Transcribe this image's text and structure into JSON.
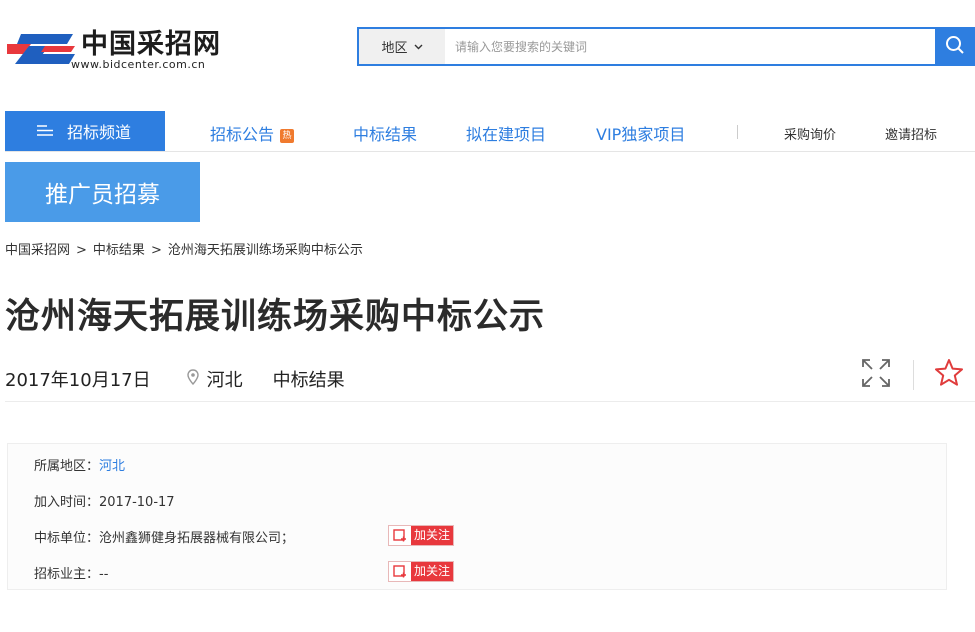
{
  "header": {
    "logo_title": "中国采招网",
    "logo_url": "www.bidcenter.com.cn",
    "search": {
      "region_label": "地区",
      "placeholder": "请输入您要搜索的关键词",
      "value": ""
    }
  },
  "nav": {
    "channel_label": "招标频道",
    "items": [
      {
        "label": "招标公告",
        "badge": "热"
      },
      {
        "label": "中标结果"
      },
      {
        "label": "拟在建项目"
      },
      {
        "label": "VIP独家项目"
      },
      {
        "label": "采购询价"
      },
      {
        "label": "邀请招标"
      }
    ]
  },
  "promo": {
    "label": "推广员招募"
  },
  "breadcrumb": {
    "items": [
      "中国采招网",
      "中标结果",
      "沧州海天拓展训练场采购中标公示"
    ],
    "separator": ">"
  },
  "article": {
    "title": "沧州海天拓展训练场采购中标公示",
    "date": "2017年10月17日",
    "region": "河北",
    "type": "中标结果"
  },
  "info": {
    "region_label": "所属地区：",
    "region_value": "河北",
    "time_label": "加入时间：",
    "time_value": "2017-10-17",
    "winner_label": "中标单位：",
    "winner_value": "沧州鑫狮健身拓展器械有限公司；",
    "owner_label": "招标业主：",
    "owner_value": "--",
    "follow_label": "加关注"
  },
  "colors": {
    "accent": "#2e7ee0",
    "promo": "#4a9be8",
    "hot": "#f07a2e",
    "follow": "#e8383d",
    "star": "#e03c3c"
  }
}
